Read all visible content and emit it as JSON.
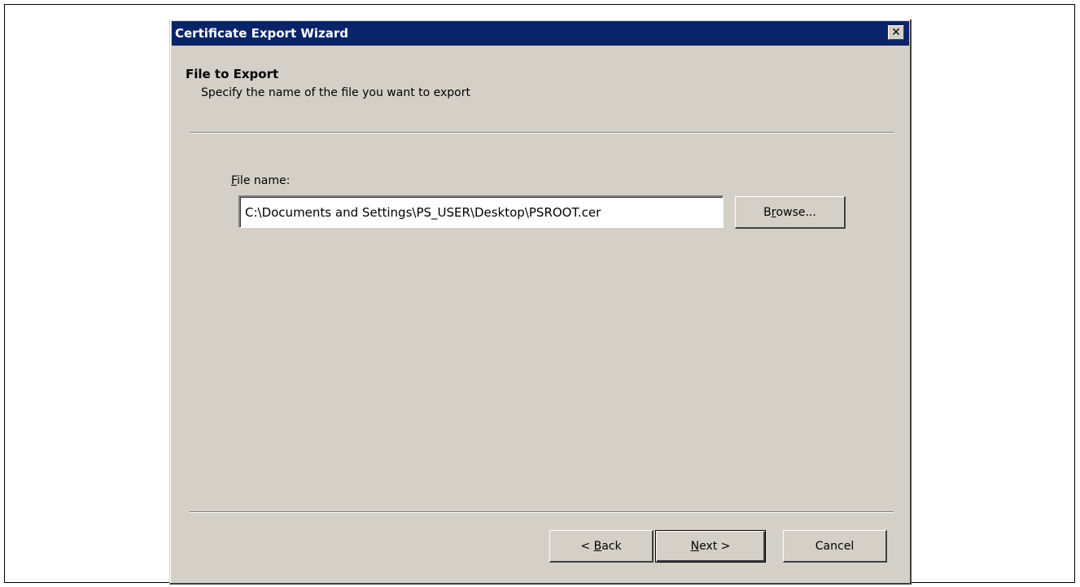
{
  "window": {
    "title": "Certificate Export Wizard",
    "close_glyph": "✕"
  },
  "header": {
    "title": "File to Export",
    "subtitle": "Specify the name of the file you want to export"
  },
  "form": {
    "label_prefix": "",
    "label_accel": "F",
    "label_rest": "ile name:",
    "file_value": "C:\\Documents and Settings\\PS_USER\\Desktop\\PSROOT.cer",
    "browse_pre": "B",
    "browse_accel": "r",
    "browse_post": "owse..."
  },
  "footer": {
    "back_pre": "< ",
    "back_accel": "B",
    "back_post": "ack",
    "next_accel": "N",
    "next_post": "ext >",
    "cancel_label": "Cancel"
  },
  "colors": {
    "titlebar": "#0a246a",
    "dialog_face": "#d4d0c8"
  }
}
